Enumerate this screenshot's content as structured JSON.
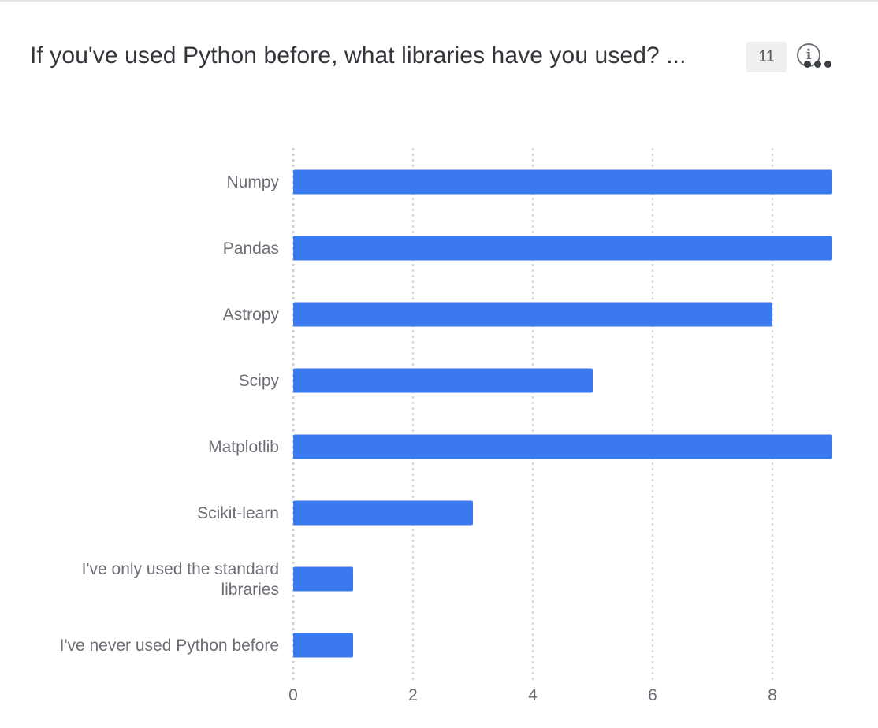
{
  "header": {
    "title": "If you've used Python before, what libraries have you used? ...",
    "count_badge": "11",
    "info_icon": "info-circle-icon",
    "more_icon": "ellipsis-icon"
  },
  "colors": {
    "bar": "#3b79f0",
    "grid": "#d9d9d9",
    "text": "#6b6f75"
  },
  "chart_data": {
    "type": "bar",
    "orientation": "horizontal",
    "title": "If you've used Python before, what libraries have you used? ...",
    "categories": [
      [
        "Numpy"
      ],
      [
        "Pandas"
      ],
      [
        "Astropy"
      ],
      [
        "Scipy"
      ],
      [
        "Matplotlib"
      ],
      [
        "Scikit-learn"
      ],
      [
        "I've only used the standard",
        "libraries"
      ],
      [
        "I've never used Python before"
      ]
    ],
    "values": [
      9,
      9,
      8,
      5,
      9,
      3,
      1,
      1
    ],
    "xticks": [
      0,
      2,
      4,
      6,
      8
    ],
    "xlim": [
      0,
      9
    ],
    "grid": "vertical dotted"
  }
}
